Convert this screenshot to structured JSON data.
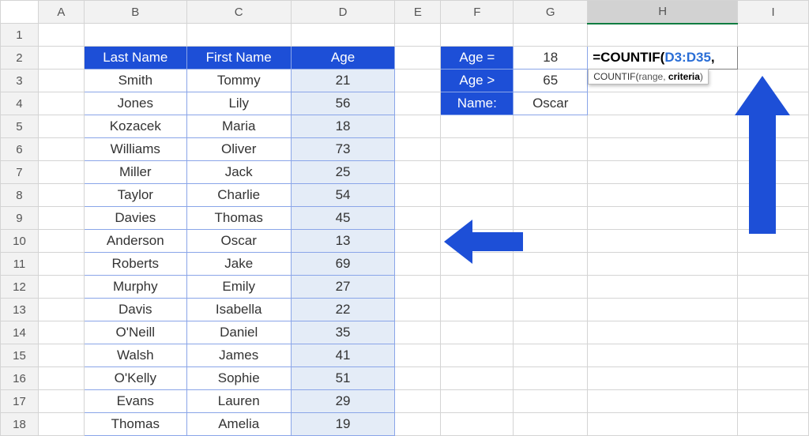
{
  "columns": [
    "A",
    "B",
    "C",
    "D",
    "E",
    "F",
    "G",
    "H",
    "I"
  ],
  "active_column": "H",
  "row_count": 18,
  "table": {
    "headers": {
      "last": "Last Name",
      "first": "First Name",
      "age": "Age"
    },
    "rows": [
      {
        "last": "Smith",
        "first": "Tommy",
        "age": 21
      },
      {
        "last": "Jones",
        "first": "Lily",
        "age": 56
      },
      {
        "last": "Kozacek",
        "first": "Maria",
        "age": 18
      },
      {
        "last": "Williams",
        "first": "Oliver",
        "age": 73
      },
      {
        "last": "Miller",
        "first": "Jack",
        "age": 25
      },
      {
        "last": "Taylor",
        "first": "Charlie",
        "age": 54
      },
      {
        "last": "Davies",
        "first": "Thomas",
        "age": 45
      },
      {
        "last": "Anderson",
        "first": "Oscar",
        "age": 13
      },
      {
        "last": "Roberts",
        "first": "Jake",
        "age": 69
      },
      {
        "last": "Murphy",
        "first": "Emily",
        "age": 27
      },
      {
        "last": "Davis",
        "first": "Isabella",
        "age": 22
      },
      {
        "last": "O'Neill",
        "first": "Daniel",
        "age": 35
      },
      {
        "last": "Walsh",
        "first": "James",
        "age": 41
      },
      {
        "last": "O'Kelly",
        "first": "Sophie",
        "age": 51
      },
      {
        "last": "Evans",
        "first": "Lauren",
        "age": 29
      },
      {
        "last": "Thomas",
        "first": "Amelia",
        "age": 19
      }
    ]
  },
  "criteria": [
    {
      "label": "Age =",
      "value": "18"
    },
    {
      "label": "Age >",
      "value": "65"
    },
    {
      "label": "Name:",
      "value": "Oscar"
    }
  ],
  "formula": {
    "prefix": "=",
    "fn": "COUNTIF",
    "paren": "(",
    "range": "D3:D35",
    "tail": ","
  },
  "tooltip": {
    "fn": "COUNTIF(",
    "arg1": "range",
    "sep": ", ",
    "arg2": "criteria",
    "close": ")"
  }
}
